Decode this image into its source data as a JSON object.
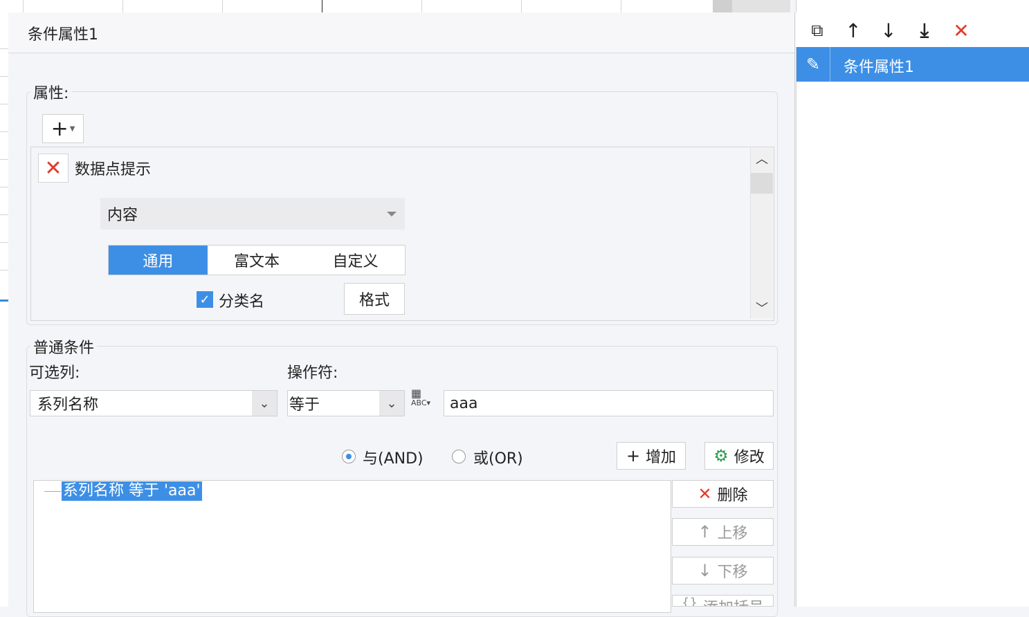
{
  "editor": {
    "title": "条件属性1"
  },
  "properties": {
    "group_label": "属性:",
    "add_label": "+",
    "item": {
      "name": "数据点提示",
      "content_select": "内容",
      "tabs": [
        "通用",
        "富文本",
        "自定义"
      ],
      "active_tab": 0,
      "checkbox_label": "分类名",
      "checkbox_checked": true,
      "format_button": "格式"
    }
  },
  "condition": {
    "group_label": "普通条件",
    "column_label": "可选列:",
    "column_value": "系列名称",
    "operator_label": "操作符:",
    "operator_value": "等于",
    "value_input": "aaa",
    "radio_and": "与(AND)",
    "radio_or": "或(OR)",
    "add_button": "增加",
    "modify_button": "修改",
    "delete_button": "删除",
    "move_up_button": "上移",
    "move_down_button": "下移",
    "add_bracket_button": "添加括号",
    "tree_item": "系列名称 等于 'aaa'"
  },
  "right_panel": {
    "item_label": "条件属性1"
  },
  "colors": {
    "accent": "#3d8fe6",
    "danger": "#e23a2a"
  }
}
